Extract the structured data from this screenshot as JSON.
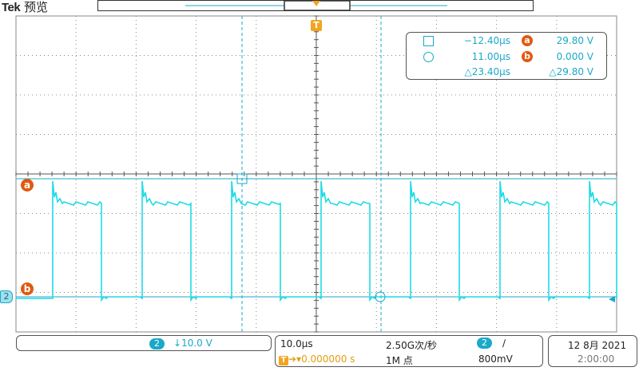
{
  "header": {
    "brand": "Tek",
    "mode": "预览",
    "trigger_label": "T"
  },
  "colors": {
    "trace": "#1fdbe6",
    "cursor": "#1aa9c8",
    "marker": "#e05a12",
    "trigger": "#f2a520",
    "grid": "#888888"
  },
  "cursor_readout": {
    "cursor1_time": "−12.40µs",
    "cursor2_time": "11.00µs",
    "delta_time": "△23.40µs",
    "cursor_a_label": "a",
    "cursor_a_value": "29.80 V",
    "cursor_b_label": "b",
    "cursor_b_value": "0.000 V",
    "delta_voltage": "△29.80 V"
  },
  "markers": {
    "a_label": "a",
    "b_label": "b",
    "channel_label": "2"
  },
  "channel_panel": {
    "channel": "2",
    "scale": "↓10.0 V"
  },
  "timebase_panel": {
    "horizontal_scale": "10.0µs",
    "sample_rate": "2.50G次/秒",
    "trigger_position": "0.000000 s",
    "record_length": "1M 点",
    "trigger_channel": "2",
    "trigger_slope": "∕",
    "trigger_level": "800mV"
  },
  "date_panel": {
    "date": "12 8月 2021",
    "time": "2:00:00"
  }
}
